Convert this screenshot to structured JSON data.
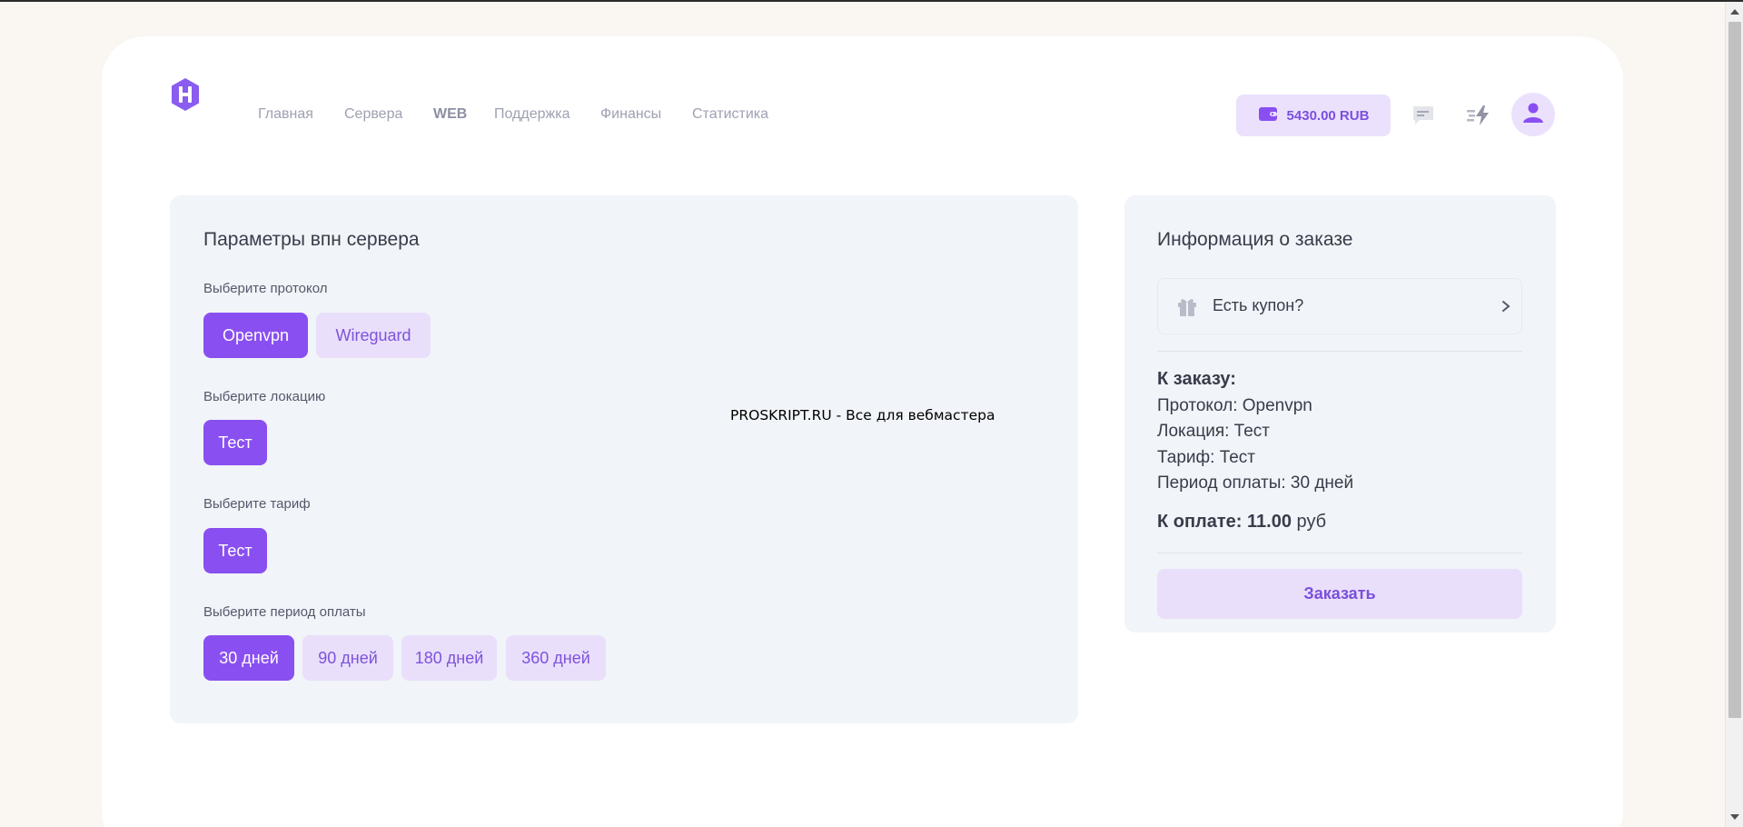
{
  "header": {
    "nav": [
      "Главная",
      "Сервера",
      "WEB",
      "Поддержка",
      "Финансы",
      "Статистика"
    ],
    "balance": "5430.00 RUB"
  },
  "params": {
    "title": "Параметры впн сервера",
    "protocol_label": "Выберите протокол",
    "protocols": [
      "Openvpn",
      "Wireguard"
    ],
    "location_label": "Выберите локацию",
    "locations": [
      "Тест"
    ],
    "tariff_label": "Выберите тариф",
    "tariffs": [
      "Тест"
    ],
    "period_label": "Выберите период оплаты",
    "periods": [
      "30 дней",
      "90 дней",
      "180 дней",
      "360 дней"
    ]
  },
  "watermark": "PROSKRIPT.RU - Все для вебмастера",
  "order": {
    "title": "Информация о заказе",
    "coupon": "Есть купон?",
    "heading": "К заказу:",
    "protocol": "Протокол: Openvpn",
    "location": "Локация: Тест",
    "tariff": "Тариф: Тест",
    "period": "Период оплаты: 30 дней",
    "total_label": "К оплате:",
    "total_value": "11.00",
    "total_currency": "руб",
    "button": "Заказать"
  },
  "colors": {
    "accent": "#8a4ff1",
    "accent_light": "#e9dffb",
    "card_bg": "#f1f4f8",
    "page_bg": "#faf6f1"
  },
  "icons": [
    "logo-h-icon",
    "wallet-icon",
    "chat-icon",
    "bolt-icon",
    "user-icon",
    "gift-icon",
    "chevron-right-icon"
  ]
}
